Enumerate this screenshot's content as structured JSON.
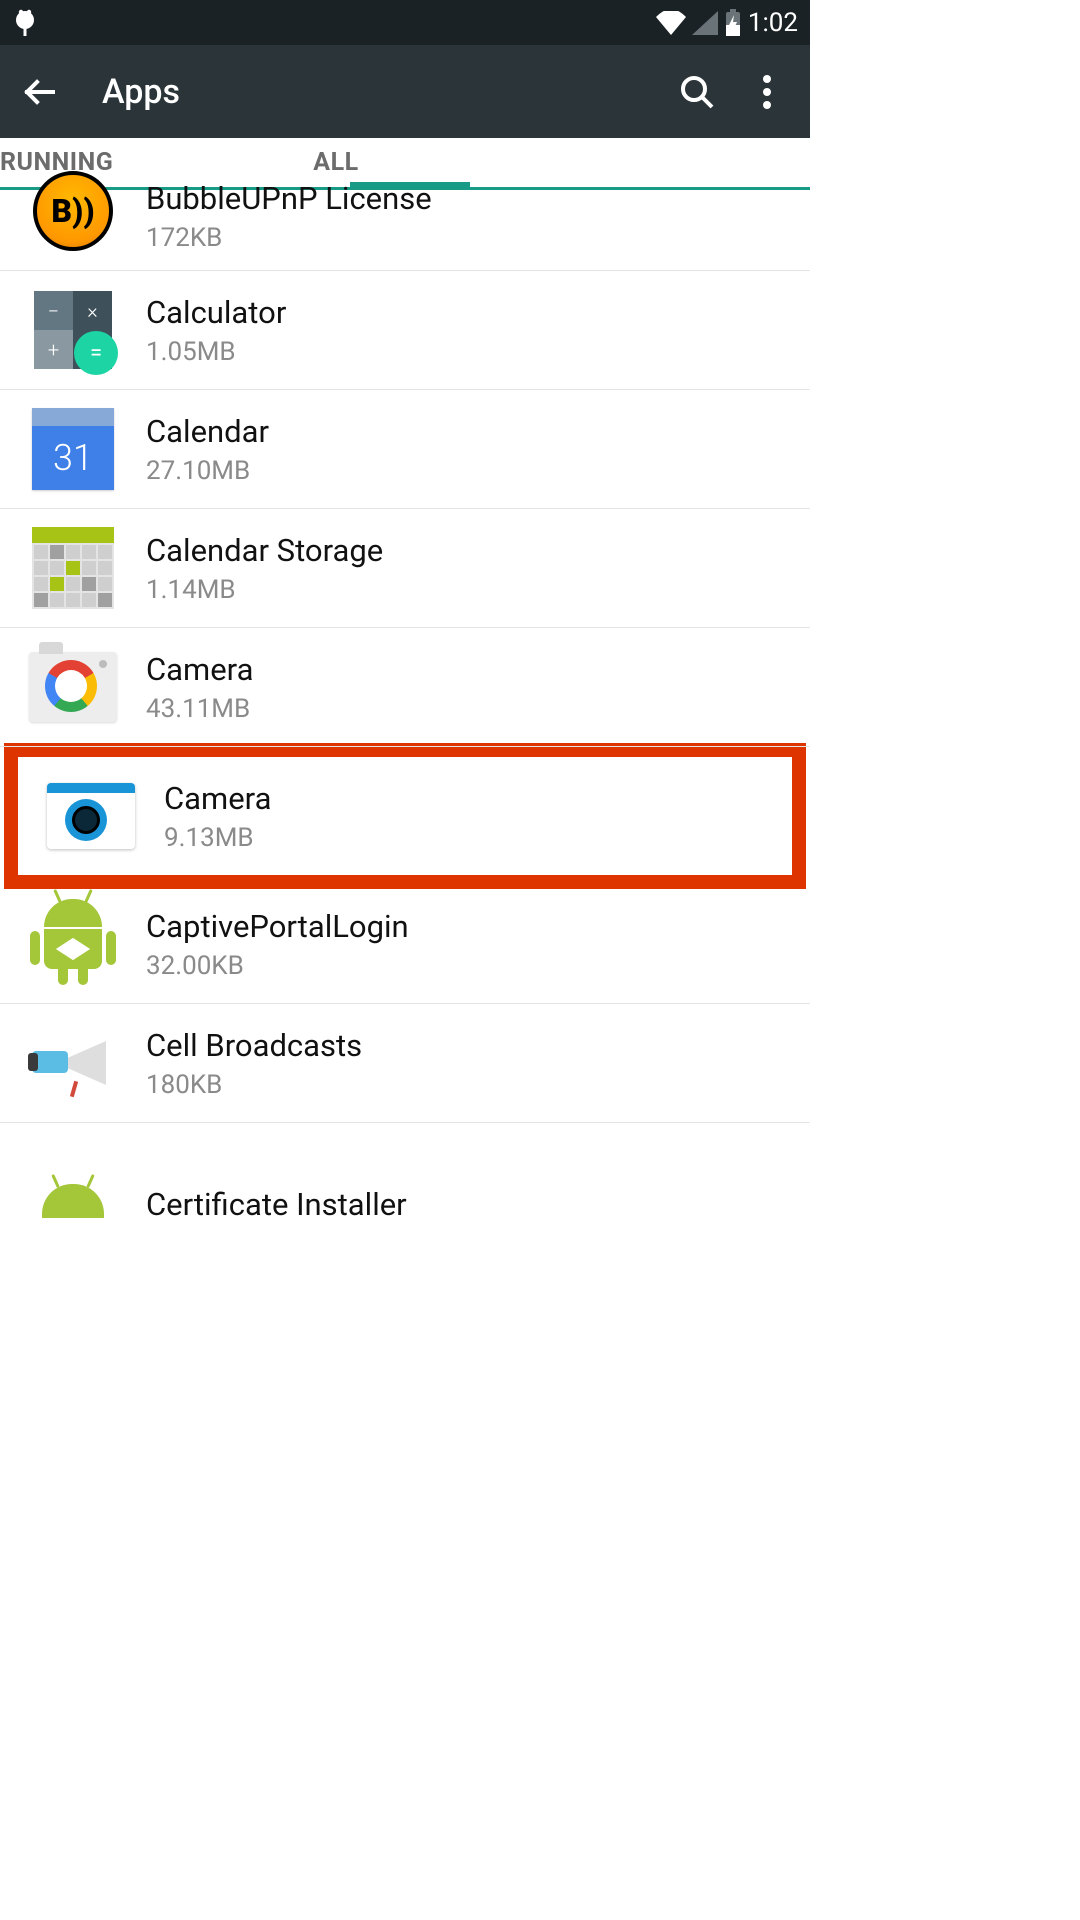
{
  "status_bar": {
    "time": "1:02"
  },
  "action_bar": {
    "title": "Apps"
  },
  "tabs": {
    "running": "RUNNING",
    "all": "ALL",
    "selected": "all"
  },
  "apps": [
    {
      "name": "BubbleUPnP License",
      "size": "172KB",
      "icon": "bubbleupnp"
    },
    {
      "name": "Calculator",
      "size": "1.05MB",
      "icon": "calculator"
    },
    {
      "name": "Calendar",
      "size": "27.10MB",
      "icon": "calendar"
    },
    {
      "name": "Calendar Storage",
      "size": "1.14MB",
      "icon": "calendar-storage"
    },
    {
      "name": "Camera",
      "size": "43.11MB",
      "icon": "google-camera"
    },
    {
      "name": "Camera",
      "size": "9.13MB",
      "icon": "camera-alt",
      "highlighted": true
    },
    {
      "name": "CaptivePortalLogin",
      "size": "32.00KB",
      "icon": "android-cube"
    },
    {
      "name": "Cell Broadcasts",
      "size": "180KB",
      "icon": "megaphone"
    },
    {
      "name": "Certificate Installer",
      "size": "",
      "icon": "android-head"
    }
  ]
}
